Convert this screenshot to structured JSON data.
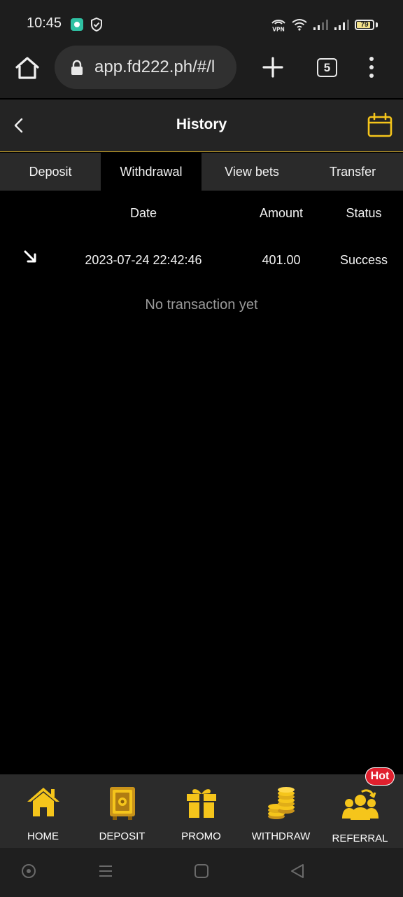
{
  "status_bar": {
    "time": "10:45",
    "vpn_label": "VPN",
    "battery_level": "79",
    "icons": [
      "app-notification-icon",
      "shield-icon",
      "vpn-icon",
      "wifi-icon",
      "signal-icon",
      "signal-icon",
      "battery-icon"
    ]
  },
  "browser": {
    "url": "app.fd222.ph/#/l",
    "tab_count": "5",
    "icons": [
      "home-icon",
      "lock-icon",
      "plus-icon",
      "tabs-icon",
      "more-icon"
    ]
  },
  "header": {
    "title": "History",
    "icons": [
      "back-icon",
      "calendar-icon"
    ],
    "accent": "#f5c51b"
  },
  "tabs": [
    {
      "label": "Deposit",
      "active": false
    },
    {
      "label": "Withdrawal",
      "active": true
    },
    {
      "label": "View bets",
      "active": false
    },
    {
      "label": "Transfer",
      "active": false
    }
  ],
  "table": {
    "columns": [
      "Date",
      "Amount",
      "Status"
    ],
    "rows": [
      {
        "icon": "arrow-down-right-icon",
        "date": "2023-07-24 22:42:46",
        "amount": "401.00",
        "status": "Success"
      }
    ],
    "empty_message": "No transaction yet"
  },
  "bottom_nav": {
    "items": [
      {
        "label": "HOME",
        "icon": "home-icon"
      },
      {
        "label": "DEPOSIT",
        "icon": "safe-icon"
      },
      {
        "label": "PROMO",
        "icon": "gift-icon"
      },
      {
        "label": "WITHDRAW",
        "icon": "coins-icon"
      },
      {
        "label": "REFERRAL",
        "icon": "group-icon"
      }
    ],
    "badge": "Hot",
    "icon_color": "#f5c51b",
    "badge_color": "#e0202e"
  },
  "system_nav": {
    "icons": [
      "assistant-icon",
      "recents-icon",
      "home-square-icon",
      "back-triangle-icon"
    ]
  }
}
